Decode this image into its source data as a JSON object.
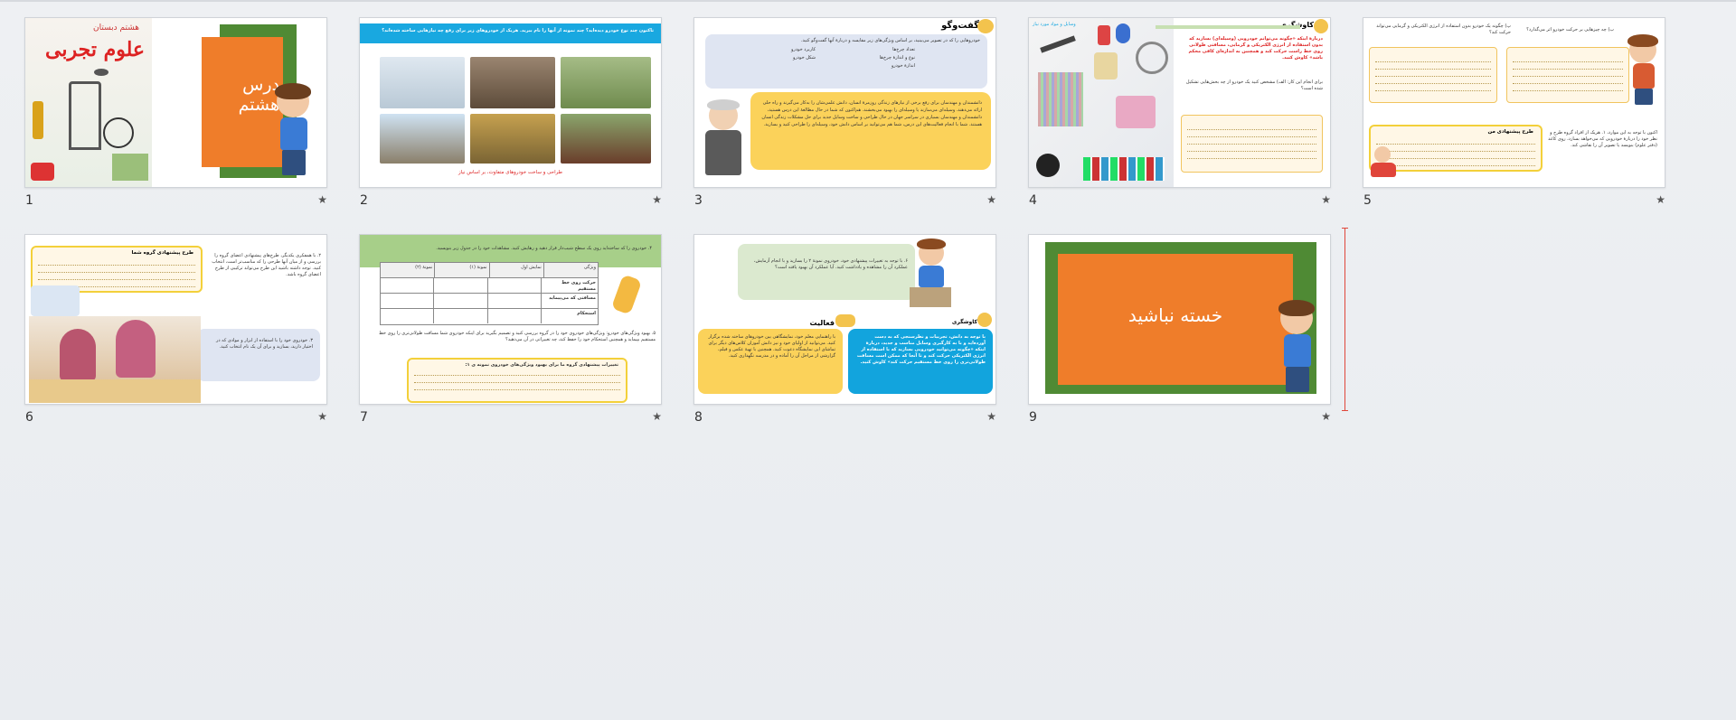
{
  "slides": [
    {
      "number": "1",
      "title": "درس هشتم",
      "cover_title": "علوم تجربی",
      "cover_subtitle": "هشتم دبستان"
    },
    {
      "number": "2",
      "question": "تاکنون چند نوع خودرو دیده‌اید؟ چند نمونه از آنها را نام ببرید. هریک از خودروهای زیر برای رفع چه نیازهایی ساخته شده‌اند؟",
      "caption": "طراحی و ساخت خودروهای متفاوت، بر اساس نیاز"
    },
    {
      "number": "3",
      "heading": "گفت‌وگو",
      "intro": "خودروهایی را که در تصویر می‌بینید، بر اساس ویژگی‌های زیر مقایسه و دربارهٔ آنها گفت‌وگو کنید.",
      "bullets": [
        "تعداد چرخ‌ها",
        "کاربرد خودرو",
        "نوع و اندازهٔ چرخ‌ها",
        "شکل خودرو",
        "اندازهٔ خودرو"
      ],
      "paragraph": "دانشمندان و مهندسان برای رفع برخی از نیازهای زندگی روزمرهٔ انسان، دانش علمی‌شان را به‌کار می‌گیرند و راه حلی ارائه می‌دهند. وسیله‌ای می‌سازند یا وسیله‌ای را بهبود می‌بخشند. هم‌اکنون که شما در حال مطالعهٔ این درس هستید، دانشمندان و مهندسان بسیاری در سراسر جهان در حال طراحی و ساخت وسایل جدید برای حل مشکلات زندگی انسان هستند. شما با انجام فعالیت‌های این درس، شما هم می‌توانید بر اساس دانش خود، وسیله‌ای را طراحی کنید و بسازید."
    },
    {
      "number": "4",
      "heading": "کاوشگری",
      "tag": "وسایل و مواد مورد نیاز",
      "text": "دربارهٔ اینکه «چگونه می‌توانم خودرویی (وسیله‌ای) بسازید که بدون استفاده از انرژی الکتریکی و گرمایی، مسافتی طولانی روی خط راست حرکت کند و همچنین به اندازه‌ای کافی محکم باشد» کاوش کنید.",
      "sub": "برای انجام این کار: الف) مشخص کنید یک خودرو از چه بخش‌هایی تشکیل شده است؟"
    },
    {
      "number": "5",
      "q1": "ب) چه چیزهایی بر حرکت خودرو اثر می‌گذارد؟",
      "q2": "پ) چگونه یک خودرو بدون استفاده از انرژی الکتریکی و گرمایی می‌تواند حرکت کند؟",
      "box_title": "طرح پیشنهادی من",
      "text": "اکنون با توجه به این موارد، ۱. هریک از افراد گروه طرح و نظر خود را دربارهٔ خودرویی که می‌خواهد بسازد، روی کاغذ (دفتر علوم) بنویسد یا تصویر آن را نقاشی کند."
    },
    {
      "number": "6",
      "box_title": "طرح پیشنهادی گروه شما",
      "p1": "۲. با همفکری یکدیگر، طرح‌های پیشنهادی اعضای گروه را بررسی و از میان آنها طرحی را که مناسب‌تر است، انتخاب کنید. توجه داشته باشید این طرح می‌تواند ترکیبی از طرح اعضای گروه باشد.",
      "p2": "۳. خودروی خود را با استفاده از ابزار و موادی که در اختیار دارید، بسازید و برای آن یک نام انتخاب کنید."
    },
    {
      "number": "7",
      "header": "۴. خودروی را که ساخته‌اید روی یک سطح شیب‌دار قرار دهید و رهایش کنید. مشاهدات خود را در جدول زیر بنویسید.",
      "table_head": [
        "ویژگی",
        "نمایش اول",
        "نمونهٔ (۱)",
        "نمونهٔ (۲)"
      ],
      "table_rows": [
        "حرکت روی خط مستقیم",
        "مسافتی که می‌پیماید",
        "استحکام"
      ],
      "text": "۵. بهبود ویژگی‌های خودرو: ویژگی‌های خودروی خود را در گروه بررسی کنید و تصمیم بگیرید برای اینکه خودروی شما مسافت طولانی‌تری را روی خط مستقیم بپیماید و همچنین استحکام خود را حفظ کند، چه تغییراتی در آن می‌دهید؟",
      "box_title": "تغییرات پیشنهادی گروه ما برای بهبود ویژگی‌های خودروی نمونه ی ۱:"
    },
    {
      "number": "8",
      "top_text": "۶. با توجه به تغییرات پیشنهادی خود، خودروی نمونهٔ ۲ را بسازید و با انجام آزمایش، عملکرد آن را مشاهده و یادداشت کنید. آیا عملکرد آن بهبود یافته است؟",
      "heading_left": "فعالیت",
      "heading_right": "کاوشگری",
      "left_text": "با راهنمایی معلم خود، نمایشگاهی بین خودروهای ساخته شده برگزار کنید. می‌توانید از اولیای خود و نیز دانش آموزان کلاس‌های دیگر برای تماشای این نمایشگاه دعوت کنید. همچنین با تهیهٔ عکس و فیلم، گزارشی از مراحل آن را آماده و در مدرسه نگهداری کنید.",
      "right_text": "با توجه به دانش، تجربیات و نظرسنجی که به دست آورده‌اید و با به کارگیری وسایل مناسب و جدید، دربارهٔ اینکه «چگونه می‌توانید خودرویی بسازید که با استفاده از انرژی الکتریکی حرکت کند و تا آنجا که ممکن است مسافت طولانی‌تری را روی خط مستقیم حرکت کند» کاوش کنید."
    },
    {
      "number": "9",
      "title": "خسته نباشید"
    }
  ],
  "star": "★"
}
